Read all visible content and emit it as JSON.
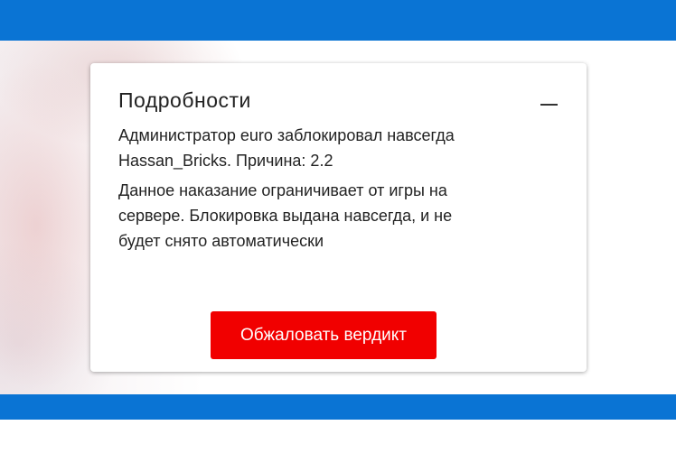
{
  "card": {
    "title": "Подробности",
    "collapse_icon": "minus-icon",
    "block_message": "Администратор euro заблокировал навсегда Hassan_Bricks. Причина: 2.2",
    "punishment_message": "Данное наказание ограничивает от игры на сервере. Блокировка выдана навсегда, и не будет снято автоматически",
    "appeal_label": "Обжаловать вердикт"
  },
  "colors": {
    "header_bar": "#0a74d4",
    "appeal_button": "#f10000"
  }
}
